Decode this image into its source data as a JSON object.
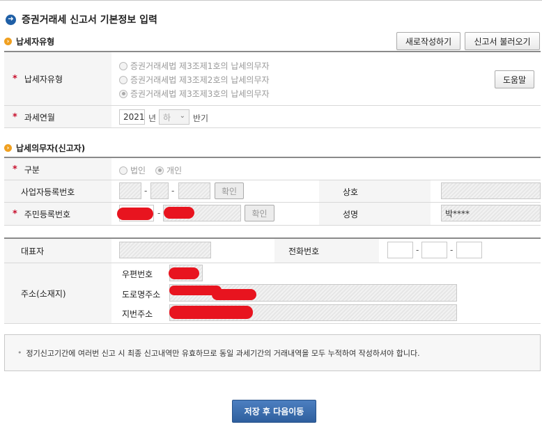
{
  "page": {
    "title": "증권거래세 신고서 기본정보 입력"
  },
  "section_taxpayer_type": {
    "title": "납세자유형",
    "new_button": "새로작성하기",
    "load_button": "신고서 불러오기",
    "type_label": "납세자유형",
    "options": [
      "증권거래세법 제3조제1호의 납세의무자",
      "증권거래세법 제3조제2호의 납세의무자",
      "증권거래세법 제3조제3호의 납세의무자"
    ],
    "selected_index": 2,
    "help_button": "도움말",
    "period_label": "과세연월",
    "year_value": "2021",
    "year_unit": "년",
    "half_value": "하",
    "half_unit": "반기"
  },
  "section_taxpayer": {
    "title": "납세의무자(신고자)",
    "kind_label": "구분",
    "kind_options": [
      "법인",
      "개인"
    ],
    "kind_selected": "개인",
    "biz_no_label": "사업자등록번호",
    "biz_confirm": "확인",
    "trade_name_label": "상호",
    "resident_no_label": "주민등록번호",
    "resident_confirm": "확인",
    "name_label": "성명",
    "name_value": "박****",
    "dash": "-"
  },
  "section_address": {
    "rep_label": "대표자",
    "phone_label": "전화번호",
    "address_label": "주소(소재지)",
    "zip_label": "우편번호",
    "road_label": "도로명주소",
    "lot_label": "지번주소"
  },
  "notice": {
    "bullet": "•",
    "text": "정기신고기간에 여러번 신고 시 최종 신고내역만 유효하므로 동일 과세기간의 거래내역을 모두 누적하여 작성하셔야 합니다."
  },
  "footer": {
    "save_next": "저장 후 다음이동"
  },
  "icons": {
    "title_icon": "arrow-right-circle-icon",
    "section_icon": "orange-bullet-icon",
    "select_icon": "chevron-down-icon"
  },
  "colors": {
    "primary": "#2f5f9e",
    "required": "#c8102e",
    "redaction": "#e8141f",
    "section_bullet": "#f0a020"
  }
}
